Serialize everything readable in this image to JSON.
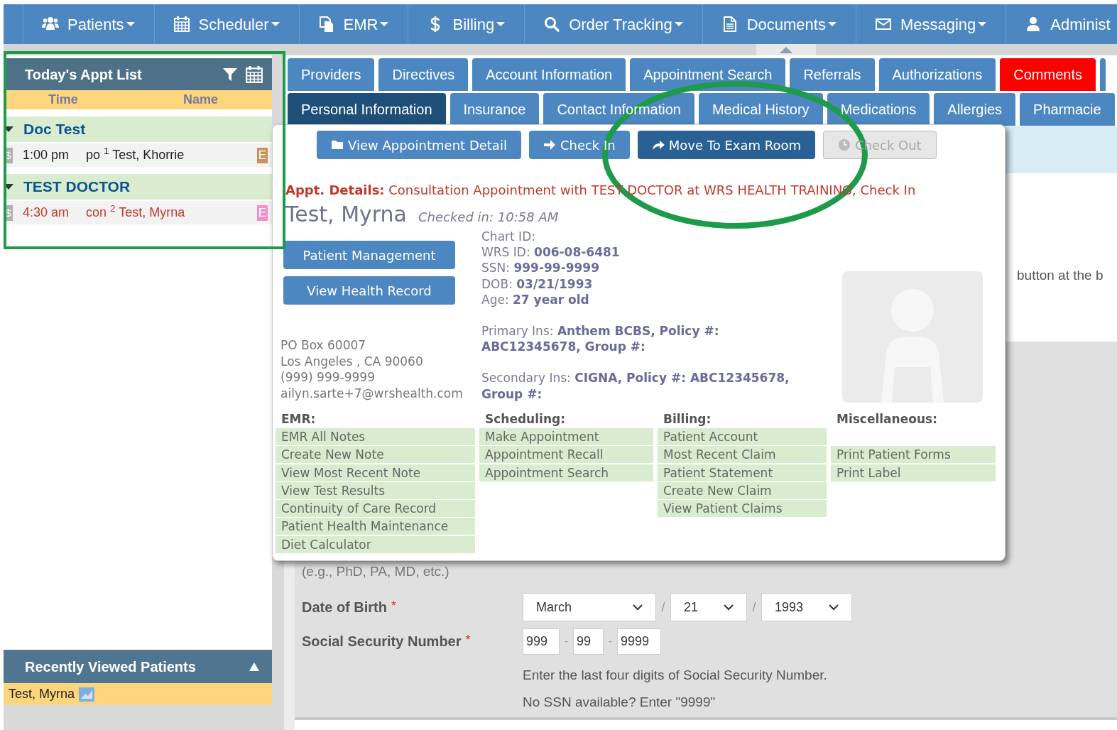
{
  "nav": {
    "items": [
      {
        "label": "Patients"
      },
      {
        "label": "Scheduler"
      },
      {
        "label": "EMR"
      },
      {
        "label": "Billing"
      },
      {
        "label": "Order Tracking"
      },
      {
        "label": "Documents"
      },
      {
        "label": "Messaging"
      },
      {
        "label": "Administ"
      }
    ]
  },
  "appt_list": {
    "title": "Today's Appt List",
    "columns": [
      "Time",
      "Name"
    ],
    "groups": [
      {
        "name": "Doc Test",
        "expanded": true,
        "appointments": [
          {
            "billing_mark": "$",
            "time": "1:00 pm",
            "type": "po",
            "number": "1",
            "patient": "Test, Khorrie",
            "color": "#222222",
            "badge": {
              "text": "E",
              "color": "#c8925a"
            }
          }
        ]
      },
      {
        "name": "TEST DOCTOR",
        "expanded": true,
        "appointments": [
          {
            "billing_mark": "$",
            "time": "4:30 am",
            "type": "con",
            "number": "2",
            "patient": "Test, Myrna",
            "color": "#c0392b",
            "badge": {
              "text": "E",
              "color": "#f090c8"
            }
          }
        ]
      }
    ]
  },
  "recently_viewed": {
    "title": "Recently Viewed Patients",
    "expanded": true,
    "patients": [
      "Test, Myrna"
    ]
  },
  "tabs": [
    [
      {
        "label": "Providers",
        "selected": false
      },
      {
        "label": "Directives",
        "selected": false
      },
      {
        "label": "Account Information",
        "selected": false
      },
      {
        "label": "Appointment Search",
        "selected": false
      },
      {
        "label": "Referrals",
        "selected": false
      },
      {
        "label": "Authorizations",
        "selected": false
      },
      {
        "label": "Comments",
        "selected": false,
        "kind": "alert"
      },
      {
        "kind": "stub",
        "selected": false
      }
    ],
    [
      {
        "label": "Personal Information",
        "selected": true
      },
      {
        "label": "Insurance",
        "selected": false
      },
      {
        "label": "Contact Information",
        "selected": false
      },
      {
        "label": "Medical History",
        "selected": false
      },
      {
        "label": "Medications",
        "selected": false
      },
      {
        "label": "Allergies",
        "selected": false
      },
      {
        "label": "Pharmacie",
        "selected": false
      }
    ]
  ],
  "behind_text": "button at the b",
  "popup": {
    "buttons": [
      {
        "label": "View Appointment Detail",
        "kind": "normal"
      },
      {
        "label": "Check In",
        "kind": "normal"
      },
      {
        "label": "Move To Exam Room",
        "kind": "primary"
      },
      {
        "label": "Check Out",
        "kind": "disabled"
      }
    ],
    "appt_details_label": "Appt. Details:",
    "appt_details": "Consultation Appointment with TEST DOCTOR at WRS HEALTH TRAINING, Check In",
    "patient_name": "Test, Myrna",
    "checked_in": "Checked in: 10:58 AM",
    "side_buttons": [
      "Patient Management",
      "View Health Record"
    ],
    "info": [
      {
        "label": "Chart ID:"
      },
      {
        "label": "WRS ID:",
        "value": "006-08-6481"
      },
      {
        "label": "SSN:",
        "value": "999-99-9999"
      },
      {
        "label": "DOB:",
        "value": "03/21/1993"
      },
      {
        "label": "Age:",
        "value": "27 year old"
      }
    ],
    "insurance": [
      "Primary Ins: **Anthem BCBS, Policy #: ABC12345678, Group #:**",
      "Secondary Ins: **CIGNA, Policy #: ABC12345678, Group #:**"
    ],
    "address": [
      "PO Box 60007",
      "Los Angeles , CA 90060",
      "(999) 999-9999",
      "ailyn.sarte+7@wrshealth.com"
    ],
    "sections": [
      {
        "title": "EMR:",
        "links": [
          "EMR All Notes",
          "Create New Note",
          "View Most Recent Note",
          "View Test Results",
          "Continuity of Care Record",
          "Patient Health Maintenance",
          "Diet Calculator"
        ]
      },
      {
        "title": "Scheduling:",
        "links": [
          "Make Appointment",
          "Appointment Recall",
          "Appointment Search"
        ]
      },
      {
        "title": "Billing:",
        "links": [
          "Patient Account",
          "Most Recent Claim",
          "Patient Statement",
          "Create New Claim",
          "View Patient Claims"
        ]
      },
      {
        "title": "Miscellaneous:",
        "leading_gap": true,
        "links": [
          "Print Patient Forms",
          "Print Label"
        ]
      }
    ]
  },
  "form": {
    "hint": "(e.g., PhD, PA, MD, etc.)",
    "dob": {
      "label": "Date of Birth",
      "required_mark": "*",
      "month": "March",
      "day": "21",
      "year": "1993",
      "separator": "/"
    },
    "ssn": {
      "label": "Social Security Number",
      "required_mark": "*",
      "parts": [
        "999",
        "99",
        "9999"
      ],
      "separator": "-"
    },
    "help": [
      "Enter the last four digits of Social Security Number.",
      "No SSN available? Enter \"9999\""
    ]
  },
  "annotation_marks": [
    {
      "kind": "rectangle",
      "color": "#1e9b4a"
    },
    {
      "kind": "ellipse",
      "color": "#1e9b4a"
    }
  ]
}
